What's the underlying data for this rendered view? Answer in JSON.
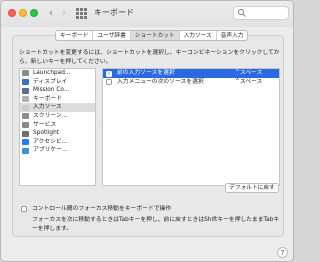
{
  "window": {
    "title": "キーボード"
  },
  "search": {
    "placeholder": ""
  },
  "tabs": [
    {
      "label": "キーボード"
    },
    {
      "label": "ユーザ辞書"
    },
    {
      "label": "ショートカット"
    },
    {
      "label": "入力ソース"
    },
    {
      "label": "音声入力"
    }
  ],
  "active_tab": "ショートカット",
  "description": "ショートカットを変更するには、ショートカットを選択し、キーコンビネーションをクリックしてから、新しいキーを押してください。",
  "categories": [
    {
      "label": "Launchpad…",
      "icon": "launchpad-icon",
      "color": "#8a8a8a"
    },
    {
      "label": "ディスプレイ",
      "icon": "display-icon",
      "color": "#3a6fd0"
    },
    {
      "label": "Mission Co…",
      "icon": "mission-control-icon",
      "color": "#5a6b8c"
    },
    {
      "label": "キーボード",
      "icon": "keyboard-icon",
      "color": "#b0b0b0"
    },
    {
      "label": "入力ソース",
      "icon": "input-sources-icon",
      "color": "#cccccc"
    },
    {
      "label": "スクリーン…",
      "icon": "screenshot-icon",
      "color": "#8c8c8c"
    },
    {
      "label": "サービス",
      "icon": "services-icon",
      "color": "#888888"
    },
    {
      "label": "Spotlight",
      "icon": "spotlight-icon",
      "color": "#6d6d6d"
    },
    {
      "label": "アクセシビ…",
      "icon": "accessibility-icon",
      "color": "#2a7bf0"
    },
    {
      "label": "アプリケー…",
      "icon": "app-shortcuts-icon",
      "color": "#3e8de0"
    }
  ],
  "selected_category": "入力ソース",
  "shortcuts": [
    {
      "label": "前の入力ソースを選択",
      "key": "^スペース",
      "checked": true,
      "selected": true
    },
    {
      "label": "入力メニューの次のソースを選択",
      "key": "^スペース",
      "checked": false,
      "selected": false
    }
  ],
  "reset_button": "デフォルトに戻す",
  "focus_toggle": {
    "label": "コントロール間のフォーカス移動をキーボードで操作",
    "checked": false,
    "description": "フォーカスを次に移動するときはTabキーを押し、前に戻すときはShiftキーを押したままTabキーを押します。"
  },
  "help": "?",
  "colors": {
    "accent": "#2a6ae0"
  }
}
